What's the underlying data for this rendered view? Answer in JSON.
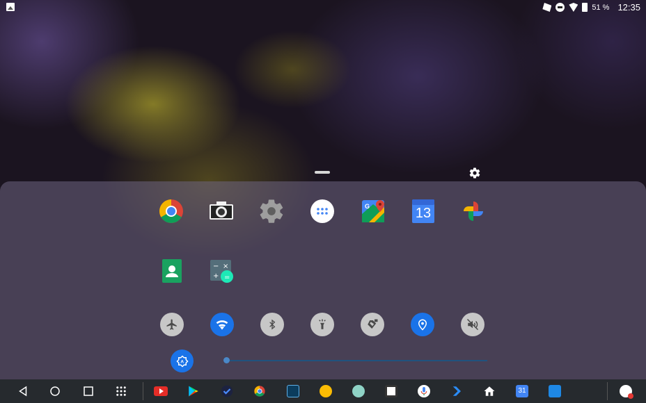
{
  "statusbar": {
    "battery_text": "51 %",
    "time": "12:35",
    "icons": [
      "image-icon",
      "data-saver-icon",
      "do-not-disturb-icon",
      "wifi-icon",
      "battery-icon"
    ]
  },
  "apps": [
    {
      "name": "chrome-app",
      "icon": "chrome-icon"
    },
    {
      "name": "camera-app",
      "icon": "camera-icon"
    },
    {
      "name": "settings-app",
      "icon": "gear-icon"
    },
    {
      "name": "app-drawer",
      "icon": "grid-dots-icon"
    },
    {
      "name": "maps-app",
      "icon": "maps-icon"
    },
    {
      "name": "calendar-app",
      "icon": "calendar-icon",
      "label": "13"
    },
    {
      "name": "photos-app",
      "icon": "pinwheel-icon"
    },
    {
      "name": "contacts-app",
      "icon": "contacts-icon"
    },
    {
      "name": "calculator-app",
      "icon": "calculator-icon"
    }
  ],
  "toggles": [
    {
      "name": "airplane-mode-toggle",
      "icon": "airplane-icon",
      "state": "off"
    },
    {
      "name": "wifi-toggle",
      "icon": "wifi-icon",
      "state": "on"
    },
    {
      "name": "bluetooth-toggle",
      "icon": "bluetooth-icon",
      "state": "off"
    },
    {
      "name": "flashlight-toggle",
      "icon": "flashlight-icon",
      "state": "off"
    },
    {
      "name": "auto-rotate-toggle",
      "icon": "rotate-lock-icon",
      "state": "off"
    },
    {
      "name": "location-toggle",
      "icon": "location-pin-icon",
      "state": "on"
    },
    {
      "name": "sound-toggle",
      "icon": "mute-icon",
      "state": "off"
    }
  ],
  "brightness": {
    "auto": true,
    "level": 0.0
  },
  "navbar": {
    "buttons": [
      "back-icon",
      "home-icon",
      "recents-icon",
      "apps-grid-icon"
    ],
    "dock": [
      "youtube-icon",
      "play-store-icon",
      "tasks-icon",
      "chrome-icon",
      "screen-recorder-icon",
      "keep-icon",
      "emoji-icon",
      "screen-capture-icon",
      "voice-search-icon",
      "arrow-app-icon",
      "home-app-icon",
      "calendar-icon",
      "cast-icon",
      "notification-icon"
    ],
    "calendar_day": "31"
  },
  "colors": {
    "accent": "#1a73e8",
    "toggle_off": "#c7c7c7"
  }
}
